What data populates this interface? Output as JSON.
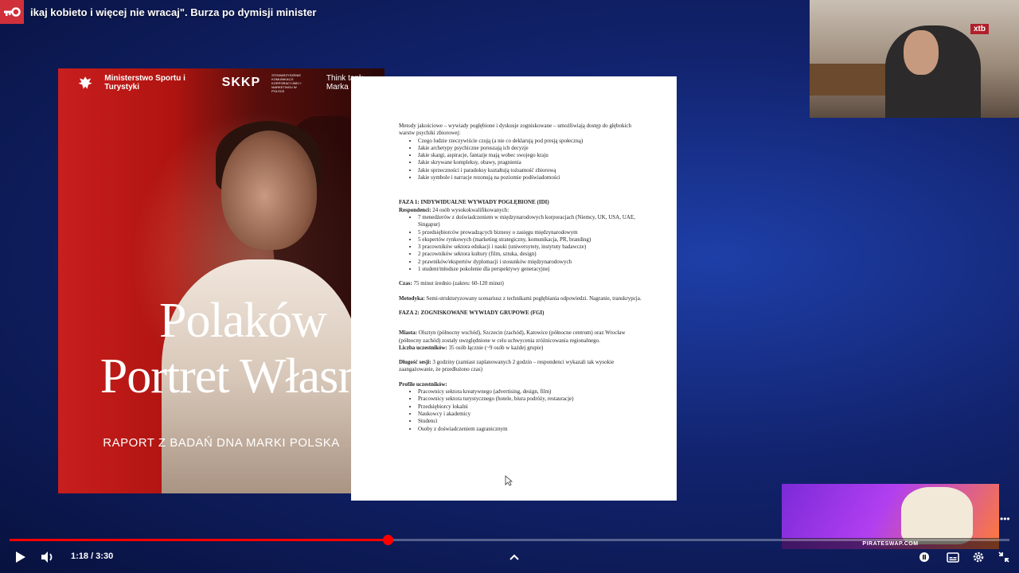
{
  "video": {
    "title": "ikaj kobieto i więcej nie wracaj\". Burza po dymisji minister",
    "current_time": "1:18",
    "duration": "3:30",
    "time_display": "1:18 / 3:30",
    "progress_fraction": 0.378
  },
  "poster": {
    "ministry": "Ministerstwo Sportu i Turystyki",
    "skkp": "SKKP",
    "skkp_sub": "STOWARZYSZENIE KOMUNIKACJI KORPORACYJNEJ I MARKETINGU W POLSCE",
    "think_tank": "Think tank Marka Pol",
    "title_line1": "Polaków",
    "title_line2": "Portret Własny",
    "subtitle": "RAPORT Z BADAŃ DNA MARKI POLSKA"
  },
  "document": {
    "intro": "Metody jakościowe – wywiady pogłębione i dyskusje zogniskowane – umożliwiają dostęp do głębokich warstw psychiki zbiorowej:",
    "intro_items": [
      "Czego ludzie rzeczywiście czują (a nie co deklarują pod presją społeczną)",
      "Jakie archetypy psychiczne poruszają ich decyzje",
      "Jakie skargi, aspiracje, fantazje mają wobec swojego kraju",
      "Jakie skrywane kompleksy, obawy, pragnienia",
      "Jakie sprzeczności i paradoksy kształtują tożsamość zbiorową",
      "Jakie symbole i narracje rezonują na poziomie podświadomości"
    ],
    "phase1_title": "FAZA 1: INDYWIDUALNE WYWIADY POGŁĘBIONE (IDI)",
    "respondents_label": "Respondenci:",
    "respondents_text": "24 osób wysokokwalifikowanych:",
    "respondents_items": [
      "7 menedżerów z doświadczeniem w międzynarodowych korporacjach (Niemcy, UK, USA, UAE, Singapur)",
      "5 przedsiębiorców prowadzących biznesy o zasięgu międzynarodowym",
      "5 ekspertów rynkowych (marketing strategiczny, komunikacja, PR, branding)",
      "3 pracowników sektora edukacji i nauki (uniwersytety, instytuty badawcze)",
      "2 pracowników sektora kultury (film, sztuka, design)",
      "2 prawników/ekspertów dyplomacji i stosunków międzynarodowych",
      "1 student/młodsze pokolenie dla perspektywy generacyjnej"
    ],
    "time_label": "Czas:",
    "time_text": "75 minut średnio (zakres: 60-120 minut)",
    "method_label": "Metodyka:",
    "method_text": "Semi-strukturyzowany scenariusz z technikami pogłębiania odpowiedzi. Nagranie, transkrypcja.",
    "phase2_title": "FAZA 2: ZOGNISKOWANE WYWIADY GRUPOWE (FGI)",
    "cities_label": "Miasta:",
    "cities_text": "Olsztyn (północny wschód), Szczecin (zachód), Katowice (północne centrum) oraz Wrocław (północny zachód) zostały uwzględnione w celu uchwycenia zróżnicowania regionalnego.",
    "participants_label": "Liczba uczestników:",
    "participants_text": "35 osób łącznie (~9 osób w każdej grupie)",
    "duration_label": "Długość sesji:",
    "duration_text": "3 godziny (zamiast zaplanowanych 2 godzin – respondenci wykazali tak wysokie zaangażowanie, że przedłużono czas)",
    "profiles_label": "Profile uczestników:",
    "profiles_items": [
      "Pracownicy sektora kreatywnego (advertising, design, film)",
      "Pracownicy sektora turystycznego (hotele, biura podróży, restauracje)",
      "Przedsiębiorcy lokalni",
      "Naukowcy i akademicy",
      "Studenci",
      "Osoby z doświadczeniem zagranicznym"
    ]
  },
  "webcam": {
    "sponsor": "xtb"
  },
  "ad": {
    "label": "PIRATESWAP.COM"
  },
  "colors": {
    "accent": "#ff0000",
    "channel": "#d0303a"
  }
}
